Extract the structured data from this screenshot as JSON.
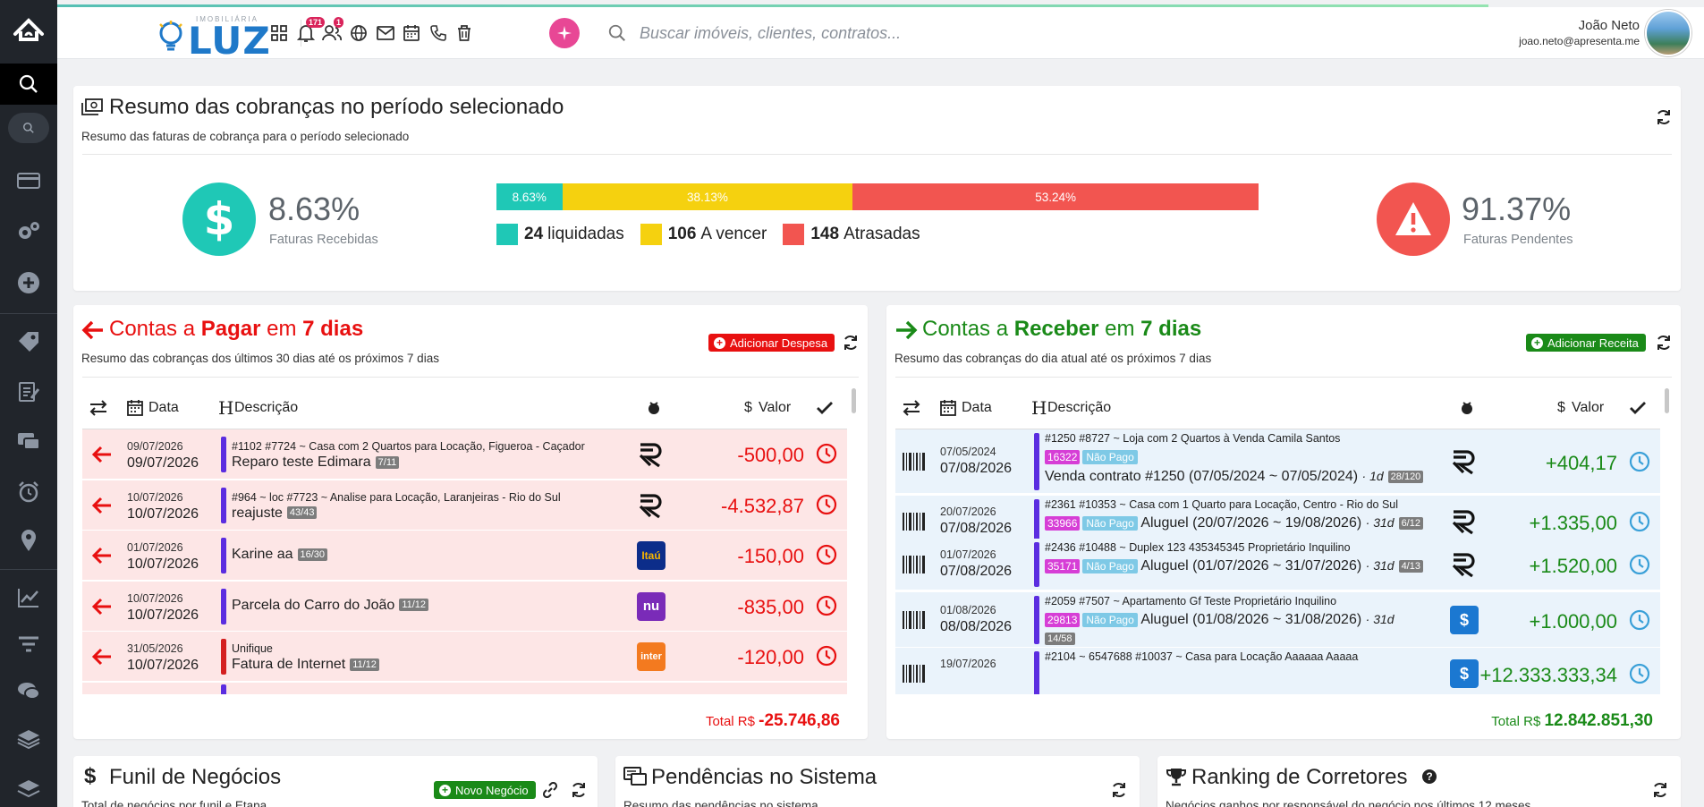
{
  "brand": {
    "logo_sub": "IMOBILIÁRIA",
    "logo_text": "LUZ"
  },
  "header": {
    "notif_badge": "171",
    "users_badge": "1",
    "search_placeholder": "Buscar imóveis, clientes, contratos...",
    "user_name": "João Neto",
    "user_email": "joao.neto@apresenta.me"
  },
  "summary": {
    "title": "Resumo das cobranças no período selecionado",
    "subtitle": "Resumo das faturas de cobrança para o período selecionado",
    "received_pct": "8.63%",
    "received_label": "Faturas Recebidas",
    "pending_pct": "91.37%",
    "pending_label": "Faturas Pendentes",
    "segments": [
      {
        "label": "8.63%",
        "value": 8.63,
        "color": "#1fc8b6"
      },
      {
        "label": "38.13%",
        "value": 38.13,
        "color": "#f5d10f"
      },
      {
        "label": "53.24%",
        "value": 53.24,
        "color": "#f25550"
      }
    ],
    "legend": [
      {
        "count": "24",
        "label": "liquidadas",
        "color": "#1fc8b6"
      },
      {
        "count": "106",
        "label": "A vencer",
        "color": "#f5d10f"
      },
      {
        "count": "148",
        "label": "Atrasadas",
        "color": "#f25550"
      }
    ]
  },
  "payables": {
    "title_a": "Contas a ",
    "title_b": "Pagar",
    "title_c": " em ",
    "title_d": "7 dias",
    "subtitle": "Resumo das cobranças dos últimos 30 dias até os próximos 7 dias",
    "add_label": "Adicionar Despesa",
    "col_date": "Data",
    "col_desc": "Descrição",
    "col_value": "Valor",
    "total_label": "Total R$",
    "total_value": "-25.746,86",
    "rows": [
      {
        "d1": "09/07/2026",
        "d2": "09/07/2026",
        "meta": "#1102  #7724 ~ Casa com 2 Quartos para Locação, Figueroa - Caçador",
        "desc": "Reparo teste Edimara",
        "tag": "7/11",
        "value": "-500,00",
        "bank": "R"
      },
      {
        "d1": "10/07/2026",
        "d2": "10/07/2026",
        "meta": "#964 ~ loc  #7723 ~ Analise para Locação, Laranjeiras - Rio do Sul",
        "desc": "reajuste",
        "tag": "43/43",
        "value": "-4.532,87",
        "bank": "R"
      },
      {
        "d1": "01/07/2026",
        "d2": "10/07/2026",
        "meta": "",
        "desc": "Karine aa",
        "tag": "16/30",
        "value": "-150,00",
        "bank": "Itaú"
      },
      {
        "d1": "10/07/2026",
        "d2": "10/07/2026",
        "meta": "",
        "desc": "Parcela do Carro do João",
        "tag": "11/12",
        "value": "-835,00",
        "bank": "nu"
      },
      {
        "d1": "31/05/2026",
        "d2": "10/07/2026",
        "meta": "Unifique",
        "desc": "Fatura de Internet",
        "tag": "11/12",
        "value": "-120,00",
        "bank": "inter"
      }
    ]
  },
  "receivables": {
    "title_a": "Contas a ",
    "title_b": "Receber",
    "title_c": " em ",
    "title_d": "7 dias",
    "subtitle": "Resumo das cobranças do dia atual até os próximos 7 dias",
    "add_label": "Adicionar Receita",
    "col_date": "Data",
    "col_desc": "Descrição",
    "col_value": "Valor",
    "total_label": "Total R$",
    "total_value": "12.842.851,30",
    "rows": [
      {
        "d1": "07/05/2024",
        "d2": "07/08/2026",
        "meta": "#1250  #8727 ~ Loja com 2 Quartos à Venda  Camila Santos",
        "code": "16322",
        "status": "Não Pago",
        "desc": "Venda contrato #1250 (07/05/2024 ~ 07/05/2024)",
        "days": "· 1d",
        "tag": "28/120",
        "value": "+404,17",
        "bank": "R"
      },
      {
        "d1": "20/07/2026",
        "d2": "07/08/2026",
        "meta": "#2361  #10353 ~ Casa com 1 Quarto para Locação, Centro - Rio do Sul",
        "code": "33966",
        "status": "Não Pago",
        "desc": "Aluguel (20/07/2026 ~ 19/08/2026)",
        "days": "· 31d",
        "tag": "6/12",
        "value": "+1.335,00",
        "bank": "R"
      },
      {
        "d1": "01/07/2026",
        "d2": "07/08/2026",
        "meta": "#2436  #10488 ~ Duplex 123  435345345  Proprietário  Inquilino",
        "code": "35171",
        "status": "Não Pago",
        "desc": "Aluguel (01/07/2026 ~ 31/07/2026)",
        "days": "· 31d",
        "tag": "4/13",
        "value": "+1.520,00",
        "bank": "R"
      },
      {
        "d1": "01/08/2026",
        "d2": "08/08/2026",
        "meta": "#2059  #7507 ~ Apartamento  Gf Teste  Proprietário  Inquilino",
        "code": "29813",
        "status": "Não Pago",
        "desc": "Aluguel (01/08/2026 ~ 31/08/2026)",
        "days": "· 31d",
        "tag": "14/58",
        "value": "+1.000,00",
        "bank": "$"
      },
      {
        "d1": "19/07/2026",
        "d2": "",
        "meta": "#2104 ~ 6547688  #10037 ~ Casa para Locação  Aaaaaa Aaaaa",
        "code": "",
        "status": "",
        "desc": "",
        "days": "",
        "tag": "",
        "value": "+12.333.333,34",
        "bank": "$"
      }
    ]
  },
  "bottom": {
    "funnel_title": "Funil de Negócios",
    "funnel_sub": "Total de negócios por funil e Etapa",
    "funnel_add": "Novo Negócio",
    "pend_title": "Pendências no Sistema",
    "pend_sub": "Resumo das pendências no sistema",
    "rank_title": "Ranking de Corretores",
    "rank_sub": "Negócios ganhos por responsável do negócio nos últimos 12 meses"
  }
}
